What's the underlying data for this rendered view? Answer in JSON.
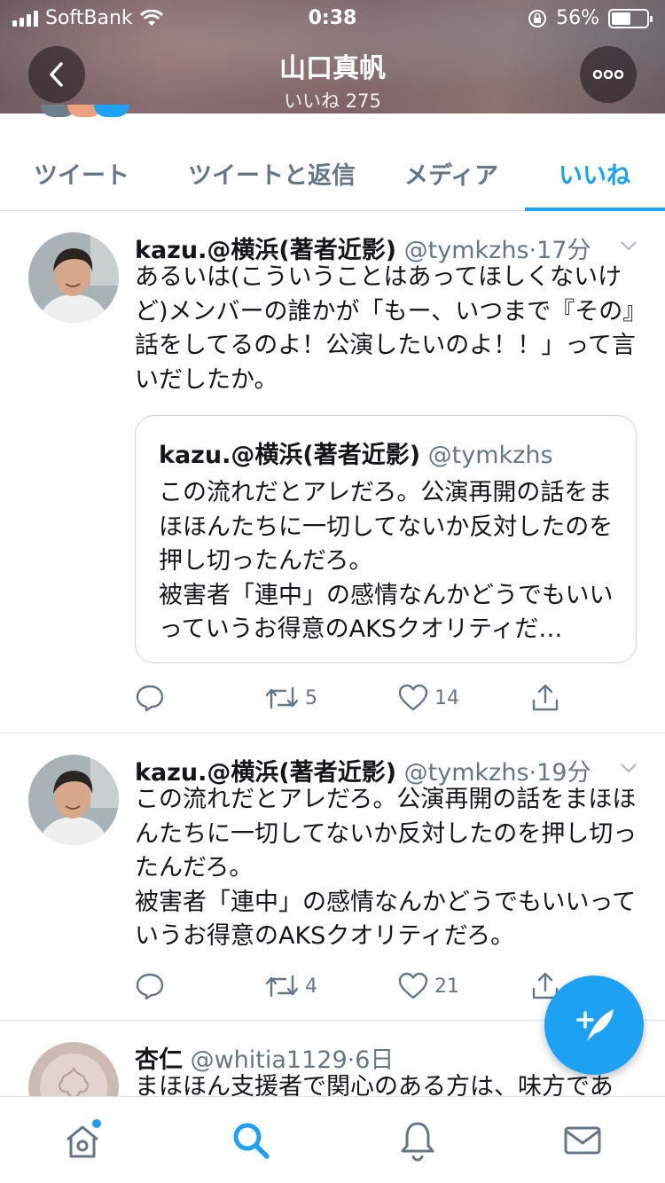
{
  "status_bar": {
    "carrier": "SoftBank",
    "time": "0:38",
    "battery": "56%",
    "battery_level": 0.56
  },
  "header": {
    "title": "山口真帆",
    "subtitle": "いいね 275"
  },
  "tabs": [
    {
      "label": "ツイート",
      "active": false
    },
    {
      "label": "ツイートと返信",
      "active": false
    },
    {
      "label": "メディア",
      "active": false
    },
    {
      "label": "いいね",
      "active": true
    }
  ],
  "tweets": [
    {
      "name": "kazu.@横浜(著者近影)",
      "handle": "@tymkzhs",
      "sep": "·",
      "time": "17分",
      "text": "あるいは(こういうことはあってほしくないけど)メンバーの誰かが「もー、いつまで『その』話をしてるのよ！公演したいのよ！！」って言いだしたか。",
      "quote": {
        "name": "kazu.@横浜(著者近影)",
        "handle": "@tymkzhs",
        "text": "この流れだとアレだろ。公演再開の話をまほほんたちに一切してないか反対したのを押し切ったんだろ。\n被害者「連中」の感情なんかどうでもいいっていうお得意のAKSクオリティだ…"
      },
      "retweets": "5",
      "likes": "14"
    },
    {
      "name": "kazu.@横浜(著者近影)",
      "handle": "@tymkzhs",
      "sep": "·",
      "time": "19分",
      "text": "この流れだとアレだろ。公演再開の話をまほほんたちに一切してないか反対したのを押し切ったんだろ。\n被害者「連中」の感情なんかどうでもいいっていうお得意のAKSクオリティだろ。",
      "retweets": "4",
      "likes": "21"
    },
    {
      "name": "杏仁",
      "handle": "@whitia1129",
      "sep": "·",
      "time": "6日",
      "text": "まほほん支援者で関心のある方は、味方であ"
    }
  ],
  "colors": {
    "accent": "#1da1f2",
    "muted": "#657786",
    "text": "#14171a"
  },
  "icons": {
    "back": "chevron-left-icon",
    "more": "more-icon",
    "reply": "reply-icon",
    "retweet": "retweet-icon",
    "like": "heart-icon",
    "share": "share-icon",
    "compose": "compose-icon",
    "home": "home-icon",
    "search": "search-icon",
    "notifications": "bell-icon",
    "messages": "mail-icon"
  }
}
